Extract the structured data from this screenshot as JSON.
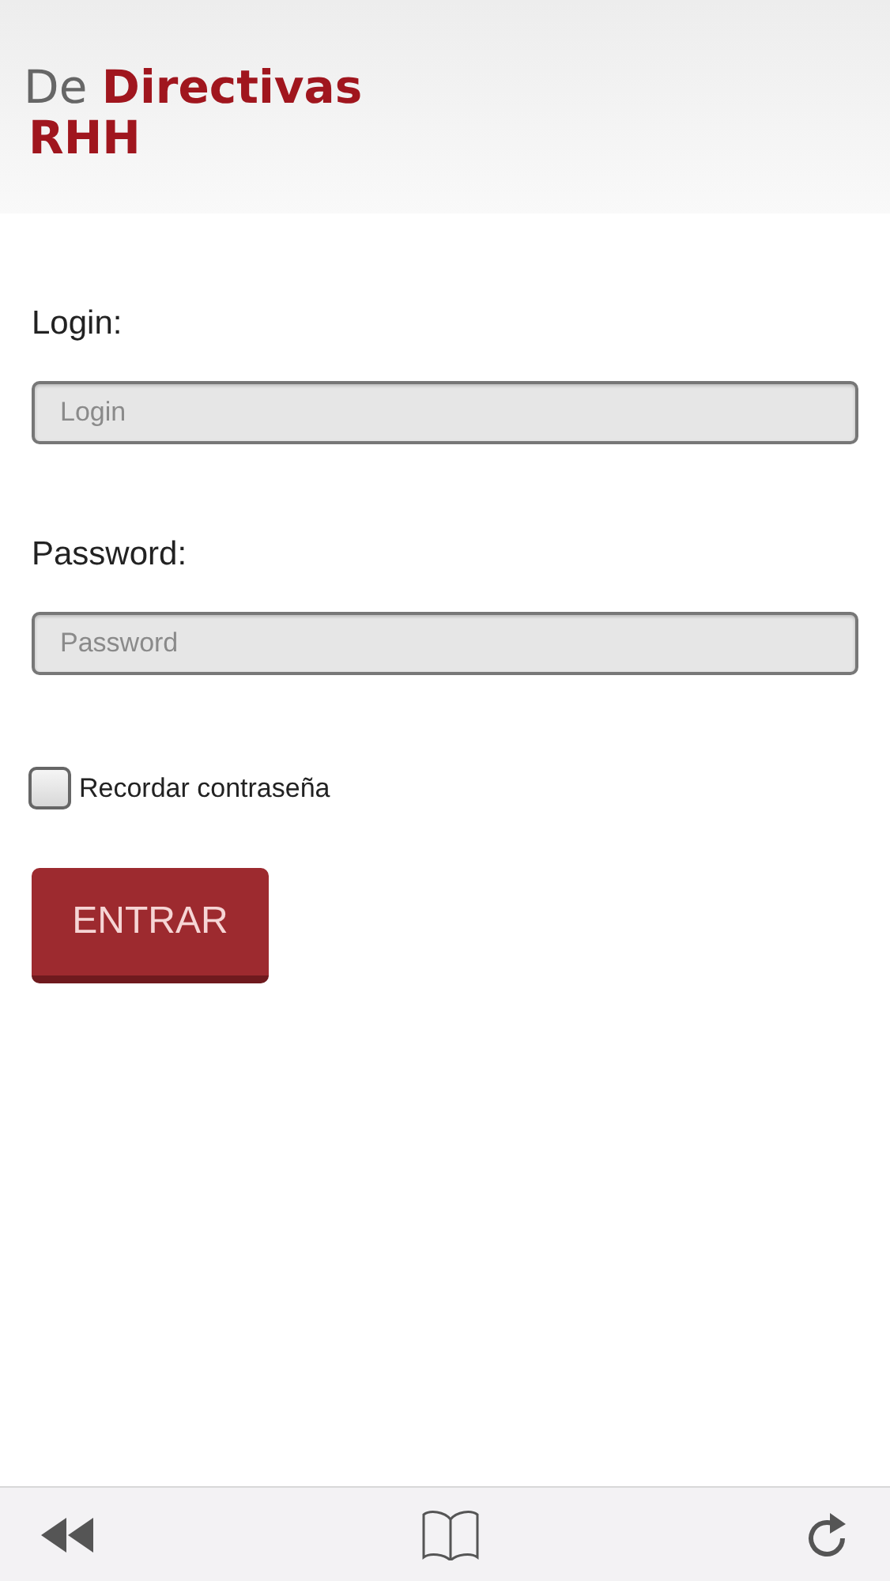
{
  "header": {
    "title_prefix": "De",
    "title_emphasis": "Directivas",
    "subtitle": "RHH"
  },
  "fields": [
    {
      "label": "Login:",
      "placeholder": "Login"
    },
    {
      "label": "Password:",
      "placeholder": "Password"
    }
  ],
  "remember": {
    "label": "Recordar contraseña",
    "checked": false
  },
  "submit": {
    "label": "ENTRAR"
  }
}
